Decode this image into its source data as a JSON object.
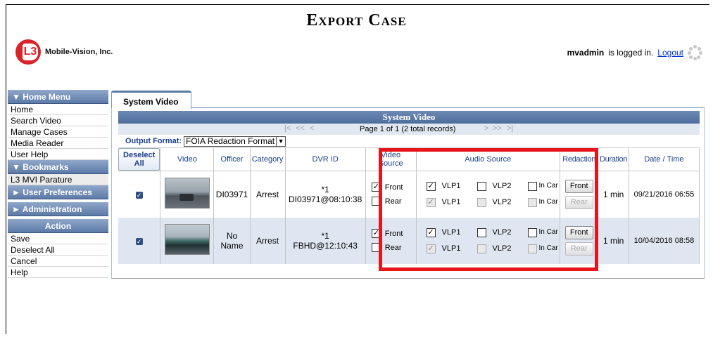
{
  "page_title": "Export Case",
  "logo": {
    "company": "Mobile-Vision, Inc.",
    "mark": "L3"
  },
  "userbar": {
    "user": "mvadmin",
    "status": "is logged in.",
    "logout": "Logout"
  },
  "sidebar": {
    "home_menu": {
      "title": "Home Menu",
      "items": [
        "Home",
        "Search Video",
        "Manage Cases",
        "Media Reader",
        "User Help"
      ]
    },
    "bookmarks": {
      "title": "Bookmarks",
      "items": [
        "L3 MVI Parature"
      ]
    },
    "user_prefs": {
      "title": "User Preferences"
    },
    "administration": {
      "title": "Administration"
    },
    "action": {
      "title": "Action",
      "items": [
        "Save",
        "Deselect All",
        "Cancel",
        "Help"
      ]
    }
  },
  "tab": {
    "label": "System Video"
  },
  "grid": {
    "title": "System Video",
    "pager": {
      "first": "|<",
      "prev_page": "<<",
      "prev": "<",
      "info": "Page 1 of 1 (2 total records)",
      "next": ">",
      "next_page": ">>",
      "last": ">|"
    },
    "output_format": {
      "label": "Output Format:",
      "value": "FOIA Redaction Format"
    },
    "columns": {
      "deselect": "Deselect All",
      "video": "Video",
      "officer": "Officer",
      "category": "Category",
      "dvr_id": "DVR ID",
      "video_source": "Video Source",
      "audio_source": "Audio Source",
      "redaction": "Redaction",
      "duration": "Duration",
      "datetime": "Date / Time"
    },
    "rows": [
      {
        "officer": "DI03971",
        "category": "Arrest",
        "dvr_star": "*1",
        "dvr_id": "DI03971@08:10:38",
        "front": "Front",
        "rear": "Rear",
        "vlp1": "VLP1",
        "vlp2": "VLP2",
        "incar": "In Car",
        "redact_front": "Front",
        "redact_rear": "Rear",
        "duration": "1 min",
        "datetime": "09/21/2016 06:55"
      },
      {
        "officer": "No Name",
        "category": "Arrest",
        "dvr_star": "*1",
        "dvr_id": "FBHD@12:10:43",
        "front": "Front",
        "rear": "Rear",
        "vlp1": "VLP1",
        "vlp2": "VLP2",
        "incar": "In Car",
        "redact_front": "Front",
        "redact_rear": "Rear",
        "duration": "1 min",
        "datetime": "10/04/2016 08:58"
      }
    ]
  },
  "colors": {
    "accent": "#5c7aa7",
    "highlight_box": "#e8141c",
    "logo_red": "#d8242a"
  }
}
